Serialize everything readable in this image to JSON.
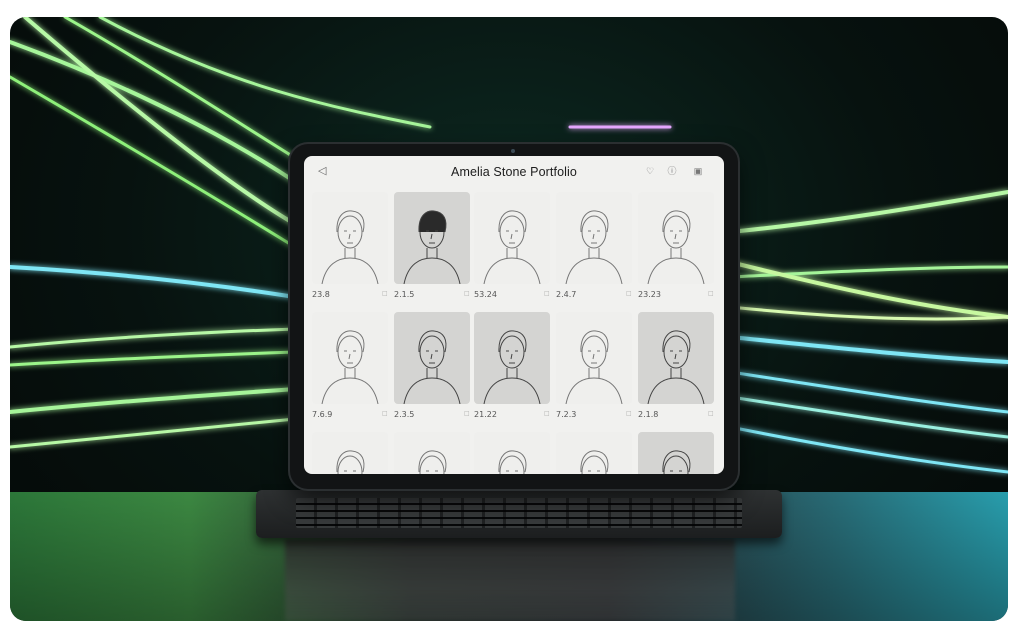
{
  "app": {
    "title": "Amelia Stone Portfolio"
  },
  "toolbar": {
    "back_icon": "back-icon",
    "right_icons": [
      "heart-icon",
      "info-icon",
      "camera-icon"
    ]
  },
  "portraits": [
    {
      "label": "23.8",
      "style": "light"
    },
    {
      "label": "2.1.5",
      "style": "dark"
    },
    {
      "label": "53.24",
      "style": "light"
    },
    {
      "label": "2.4.7",
      "style": "light"
    },
    {
      "label": "23.23",
      "style": "light"
    },
    {
      "label": "7.6.9",
      "style": "light"
    },
    {
      "label": "2.3.5",
      "style": "dark"
    },
    {
      "label": "21.22",
      "style": "dark"
    },
    {
      "label": "7.2.3",
      "style": "light"
    },
    {
      "label": "2.1.8",
      "style": "dark"
    },
    {
      "label": "",
      "style": "light"
    },
    {
      "label": "",
      "style": "light"
    },
    {
      "label": "",
      "style": "light"
    },
    {
      "label": "",
      "style": "light"
    },
    {
      "label": "",
      "style": "dark"
    }
  ],
  "colors": {
    "neon_green": "#9cf58a",
    "neon_cyan": "#7fe6f5",
    "neon_pink": "#e6a8ff",
    "screen_bg": "#f1f1ef"
  }
}
